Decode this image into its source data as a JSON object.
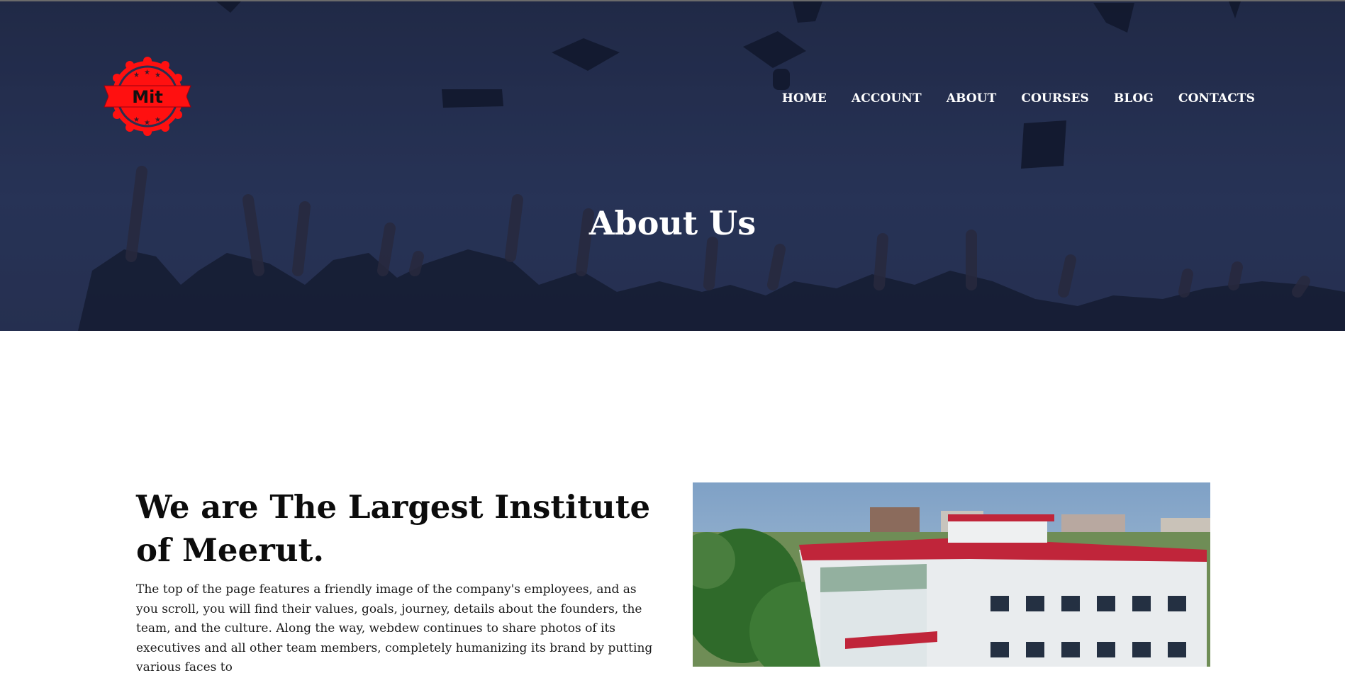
{
  "header": {
    "logo_text": "Mit",
    "nav": [
      {
        "label": "HOME"
      },
      {
        "label": "ACCOUNT"
      },
      {
        "label": "ABOUT"
      },
      {
        "label": "COURSES"
      },
      {
        "label": "BLOG"
      },
      {
        "label": "CONTACTS"
      }
    ]
  },
  "hero": {
    "title": "About Us"
  },
  "intro": {
    "heading": "We are The Largest Institute of Meerut.",
    "body": "The top of the page features a friendly image of the company's employees, and as you scroll, you will find their values, goals, journey, details about the founders, the team, and the culture. Along the way, webdew continues to share photos of its executives and all other team members, completely humanizing its brand by putting various faces to"
  },
  "colors": {
    "hero_overlay": "#2c3a5e",
    "logo_red": "#ff0000",
    "nav_text": "#ffffff",
    "building_roof": "#c0253a"
  }
}
